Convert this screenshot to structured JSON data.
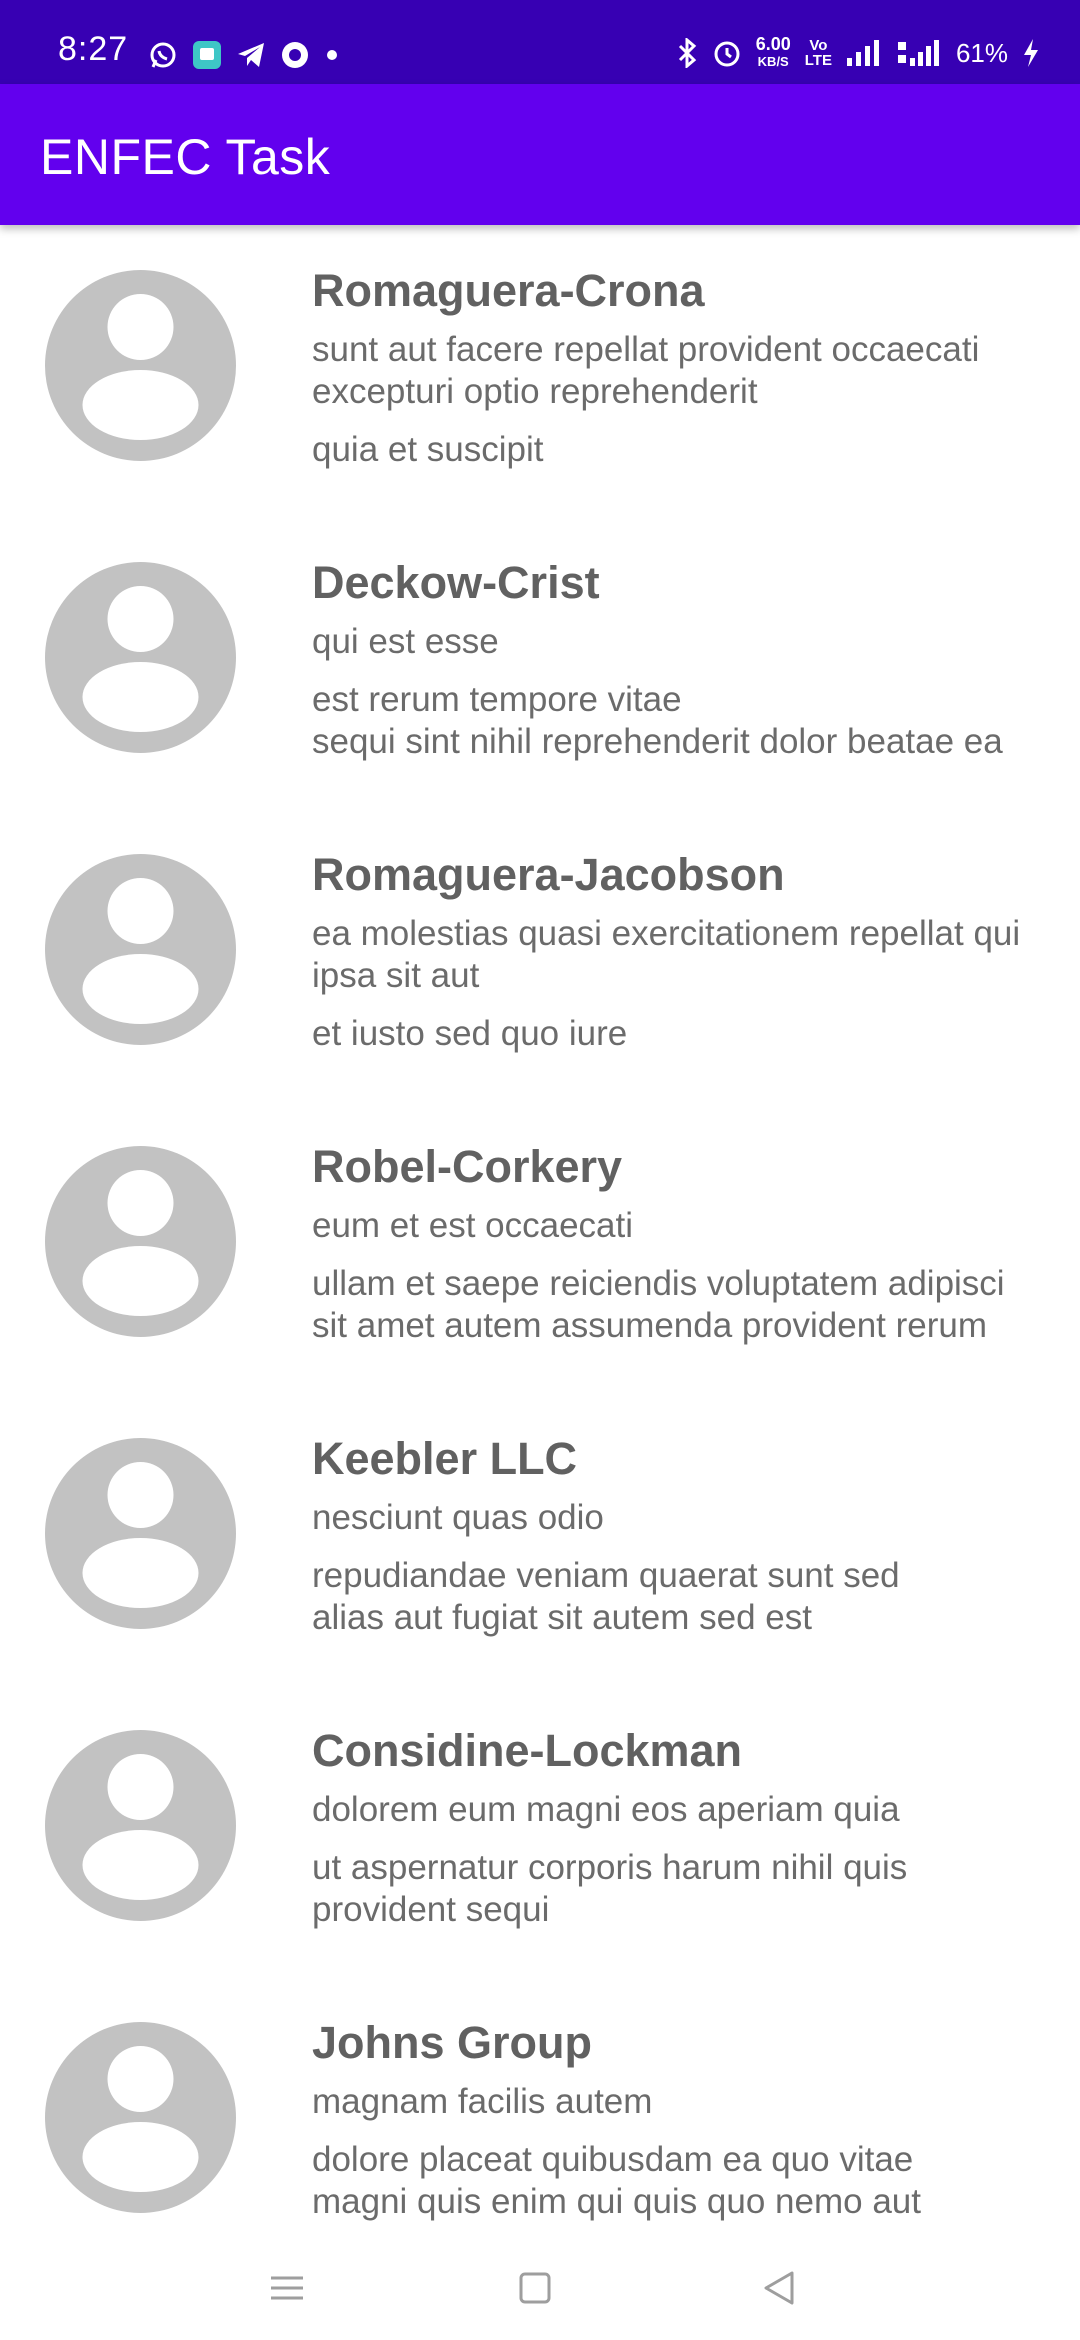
{
  "status_bar": {
    "time": "8:27",
    "notification_icons": [
      "whatsapp-icon",
      "messages-app-icon",
      "telegram-icon",
      "jio-icon",
      "dot-icon"
    ],
    "net_speed_value": "6.00",
    "net_speed_unit": "KB/S",
    "volte_top": "Vo",
    "volte_bottom": "LTE",
    "battery_percent": "61%",
    "colors": {
      "background": "#3700B3",
      "foreground": "#ffffff"
    }
  },
  "app_bar": {
    "title": "ENFEC Task",
    "color": "#6200EE"
  },
  "posts": [
    {
      "name": "Romaguera-Crona",
      "title": "sunt aut facere repellat provident occaecati excepturi optio reprehenderit",
      "body": "quia et suscipit"
    },
    {
      "name": "Deckow-Crist",
      "title": "qui est esse",
      "body": "est rerum tempore vitae\nsequi sint nihil reprehenderit dolor beatae ea"
    },
    {
      "name": "Romaguera-Jacobson",
      "title": "ea molestias quasi exercitationem repellat qui ipsa sit aut",
      "body": "et iusto sed quo iure"
    },
    {
      "name": "Robel-Corkery",
      "title": "eum et est occaecati",
      "body": "ullam et saepe reiciendis voluptatem adipisci\nsit amet autem assumenda provident rerum"
    },
    {
      "name": "Keebler LLC",
      "title": "nesciunt quas odio",
      "body": "repudiandae veniam quaerat sunt sed\nalias aut fugiat sit autem sed est"
    },
    {
      "name": "Considine-Lockman",
      "title": "dolorem eum magni eos aperiam quia",
      "body": "ut aspernatur corporis harum nihil quis\nprovident sequi"
    },
    {
      "name": "Johns Group",
      "title": "magnam facilis autem",
      "body": "dolore placeat quibusdam ea quo vitae\nmagni quis enim qui quis quo nemo aut"
    }
  ],
  "nav_bar": {
    "buttons": [
      "menu-icon",
      "home-icon",
      "back-icon"
    ]
  }
}
